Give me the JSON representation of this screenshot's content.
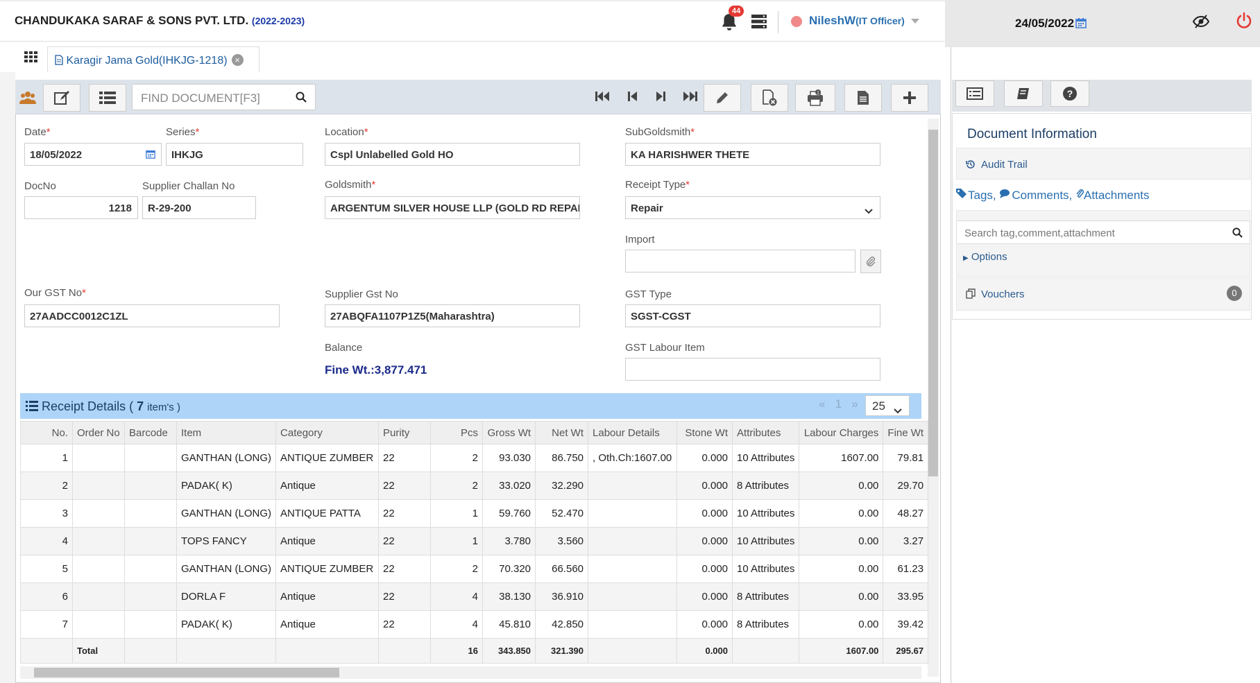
{
  "header": {
    "company": "CHANDUKAKA SARAF & SONS PVT. LTD.",
    "year": "(2022-2023)",
    "notifications": "44",
    "user": "NileshW",
    "role": "(IT Officer)",
    "date": "24/05/2022"
  },
  "tab": {
    "label": "Karagir Jama Gold(IHKJG-1218)"
  },
  "toolbar": {
    "find_placeholder": "FIND DOCUMENT[F3]"
  },
  "form": {
    "date_label": "Date",
    "date_value": "18/05/2022",
    "series_label": "Series",
    "series_value": "IHKJG",
    "location_label": "Location",
    "location_value": "Cspl Unlabelled Gold HO",
    "subgoldsmith_label": "SubGoldsmith",
    "subgoldsmith_value": "KA HARISHWER THETE",
    "docno_label": "DocNo",
    "docno_value": "1218",
    "challan_label": "Supplier Challan No",
    "challan_value": "R-29-200",
    "goldsmith_label": "Goldsmith",
    "goldsmith_value": "ARGENTUM SILVER HOUSE LLP (GOLD RD REPAIR)",
    "receipt_type_label": "Receipt Type",
    "receipt_type_value": "Repair",
    "import_label": "Import",
    "import_value": "",
    "our_gst_label": "Our GST No",
    "our_gst_value": "27AADCC0012C1ZL",
    "supplier_gst_label": "Supplier Gst No",
    "supplier_gst_value": "27ABQFA1107P1Z5(Maharashtra)",
    "gst_type_label": "GST Type",
    "gst_type_value": "SGST-CGST",
    "balance_label": "Balance",
    "balance_value": "Fine Wt.:3,877.471",
    "gst_labour_label": "GST Labour Item",
    "gst_labour_value": ""
  },
  "receipt": {
    "title": "Receipt Details (",
    "count": "7",
    "items_suffix": "item's )",
    "page_prev": "«",
    "page_num": "1",
    "page_next": "»",
    "page_size": "25",
    "columns": [
      "No.",
      "Order No",
      "Barcode",
      "Item",
      "Category",
      "Purity",
      "Pcs",
      "Gross Wt",
      "Net Wt",
      "Labour Details",
      "Stone Wt",
      "Attributes",
      "Labour Charges",
      "Fine Wt"
    ],
    "rows": [
      [
        "1",
        "",
        "",
        "GANTHAN (LONG)",
        "ANTIQUE ZUMBER",
        "22",
        "2",
        "93.030",
        "86.750",
        ", Oth.Ch:1607.00",
        "0.000",
        "10 Attributes",
        "1607.00",
        "79.81"
      ],
      [
        "2",
        "",
        "",
        "PADAK( K)",
        "Antique",
        "22",
        "2",
        "33.020",
        "32.290",
        "",
        "0.000",
        "8 Attributes",
        "0.00",
        "29.70"
      ],
      [
        "3",
        "",
        "",
        "GANTHAN (LONG)",
        "ANTIQUE PATTA",
        "22",
        "1",
        "59.760",
        "52.470",
        "",
        "0.000",
        "10 Attributes",
        "0.00",
        "48.27"
      ],
      [
        "4",
        "",
        "",
        "TOPS FANCY",
        "Antique",
        "22",
        "1",
        "3.780",
        "3.560",
        "",
        "0.000",
        "10 Attributes",
        "0.00",
        "3.27"
      ],
      [
        "5",
        "",
        "",
        "GANTHAN (LONG)",
        "ANTIQUE ZUMBER",
        "22",
        "2",
        "70.320",
        "66.560",
        "",
        "0.000",
        "10 Attributes",
        "0.00",
        "61.23"
      ],
      [
        "6",
        "",
        "",
        "DORLA F",
        "Antique",
        "22",
        "4",
        "38.130",
        "36.910",
        "",
        "0.000",
        "8 Attributes",
        "0.00",
        "33.95"
      ],
      [
        "7",
        "",
        "",
        "PADAK( K)",
        "Antique",
        "22",
        "4",
        "45.810",
        "42.850",
        "",
        "0.000",
        "8 Attributes",
        "0.00",
        "39.42"
      ]
    ],
    "total": [
      "",
      "Total",
      "",
      "",
      "",
      "",
      "16",
      "343.850",
      "321.390",
      "",
      "0.000",
      "",
      "1607.00",
      "295.67"
    ]
  },
  "sidebar": {
    "doc_info": "Document Information",
    "audit_trail": "Audit Trail",
    "tags": "Tags,",
    "comments": "Comments,",
    "attachments": "Attachments",
    "search_placeholder": "Search tag,comment,attachment",
    "options": "Options",
    "vouchers": "Vouchers",
    "vouchers_count": "0"
  }
}
